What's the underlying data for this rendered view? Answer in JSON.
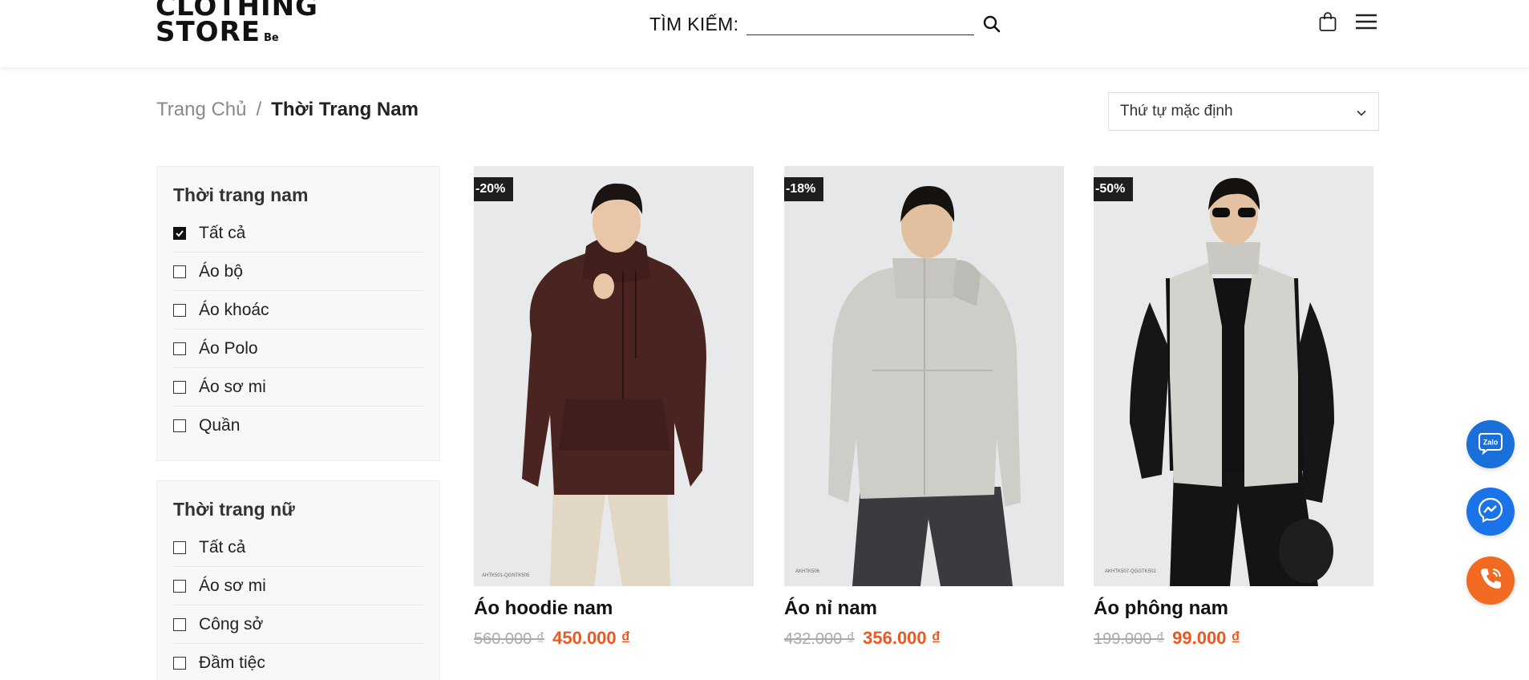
{
  "header": {
    "logo_line1": "CLOTHING",
    "logo_line2": "STORE",
    "logo_suffix": "Be",
    "search_label": "TÌM KIẾM:",
    "search_value": "",
    "search_placeholder": ""
  },
  "breadcrumb": {
    "home": "Trang Chủ",
    "separator": "/",
    "current": "Thời Trang Nam"
  },
  "sort": {
    "selected": "Thứ tự mặc định"
  },
  "sidebar": {
    "men": {
      "title": "Thời trang nam",
      "items": [
        {
          "label": "Tất cả",
          "checked": true
        },
        {
          "label": "Áo bộ",
          "checked": false
        },
        {
          "label": "Áo khoác",
          "checked": false
        },
        {
          "label": "Áo Polo",
          "checked": false
        },
        {
          "label": "Áo sơ mi",
          "checked": false
        },
        {
          "label": "Quần",
          "checked": false
        }
      ]
    },
    "women": {
      "title": "Thời trang nữ",
      "items": [
        {
          "label": "Tất cả",
          "checked": false
        },
        {
          "label": "Áo sơ mi",
          "checked": false
        },
        {
          "label": "Công sở",
          "checked": false
        },
        {
          "label": "Đầm tiệc",
          "checked": false
        }
      ]
    }
  },
  "products": [
    {
      "name": "Áo hoodie nam",
      "badge": "-20%",
      "price_old": "560.000 ₫",
      "price_new": "450.000 ₫",
      "image": "man in brown hoodie",
      "code": "AHTK501-QGNTK505"
    },
    {
      "name": "Áo nỉ nam",
      "badge": "-18%",
      "price_old": "432.000 ₫",
      "price_new": "356.000 ₫",
      "image": "man in light grey puffer jacket",
      "code": "AKHTK506"
    },
    {
      "name": "Áo phông nam",
      "badge": "-50%",
      "price_old": "199.000 ₫",
      "price_new": "99.000 ₫",
      "image": "man in grey vest and sunglasses",
      "code": "AKHTK507-QGGTK502"
    }
  ],
  "floating": {
    "zalo_label": "Zalo"
  },
  "colors": {
    "accent_price": "#e85a22",
    "badge_bg": "#1e1e1e",
    "zalo": "#1b6fd8",
    "messenger": "#1a73e8",
    "phone": "#f26a21"
  }
}
